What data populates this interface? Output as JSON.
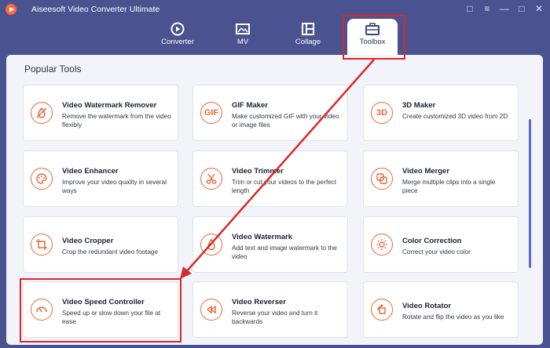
{
  "window": {
    "title": "Aiseesoft Video Converter Ultimate",
    "controls": [
      "chat-icon",
      "menu-icon",
      "minimize-icon",
      "maximize-icon",
      "close-icon"
    ]
  },
  "nav": {
    "tabs": [
      {
        "label": "Converter",
        "icon": "converter-icon"
      },
      {
        "label": "MV",
        "icon": "mv-icon"
      },
      {
        "label": "Collage",
        "icon": "collage-icon"
      },
      {
        "label": "Toolbox",
        "icon": "toolbox-icon",
        "active": true
      }
    ]
  },
  "section": {
    "title": "Popular Tools"
  },
  "tools": [
    {
      "name": "Video Watermark Remover",
      "desc": "Remove the watermark from the video flexibly",
      "icon": "watermark-remover-icon"
    },
    {
      "name": "GIF Maker",
      "desc": "Make customized GIF with your video or image files",
      "icon": "gif-icon",
      "glyph": "GIF"
    },
    {
      "name": "3D Maker",
      "desc": "Create customized 3D video from 2D",
      "icon": "3d-icon",
      "glyph": "3D"
    },
    {
      "name": "Video Enhancer",
      "desc": "Improve your video quality in several ways",
      "icon": "palette-icon"
    },
    {
      "name": "Video Trimmer",
      "desc": "Trim or cut your videos to the perfect length",
      "icon": "scissors-icon"
    },
    {
      "name": "Video Merger",
      "desc": "Merge multiple clips into a single piece",
      "icon": "merge-icon"
    },
    {
      "name": "Video Cropper",
      "desc": "Crop the redundant video footage",
      "icon": "crop-icon"
    },
    {
      "name": "Video Watermark",
      "desc": "Add text and image watermark to the video",
      "icon": "drop-icon"
    },
    {
      "name": "Color Correction",
      "desc": "Correct your video color",
      "icon": "sun-icon"
    },
    {
      "name": "Video Speed Controller",
      "desc": "Speed up or slow down your file at ease",
      "icon": "speedometer-icon"
    },
    {
      "name": "Video Reverser",
      "desc": "Reverse your video and turn it backwards",
      "icon": "rewind-icon"
    },
    {
      "name": "Video Rotator",
      "desc": "Rotate and flip the video as you like",
      "icon": "rotate-icon"
    }
  ],
  "colors": {
    "header_bg": "#4a5390",
    "accent": "#e8673c",
    "highlight": "#d7292b",
    "panel_bg": "#f3f4f9"
  }
}
